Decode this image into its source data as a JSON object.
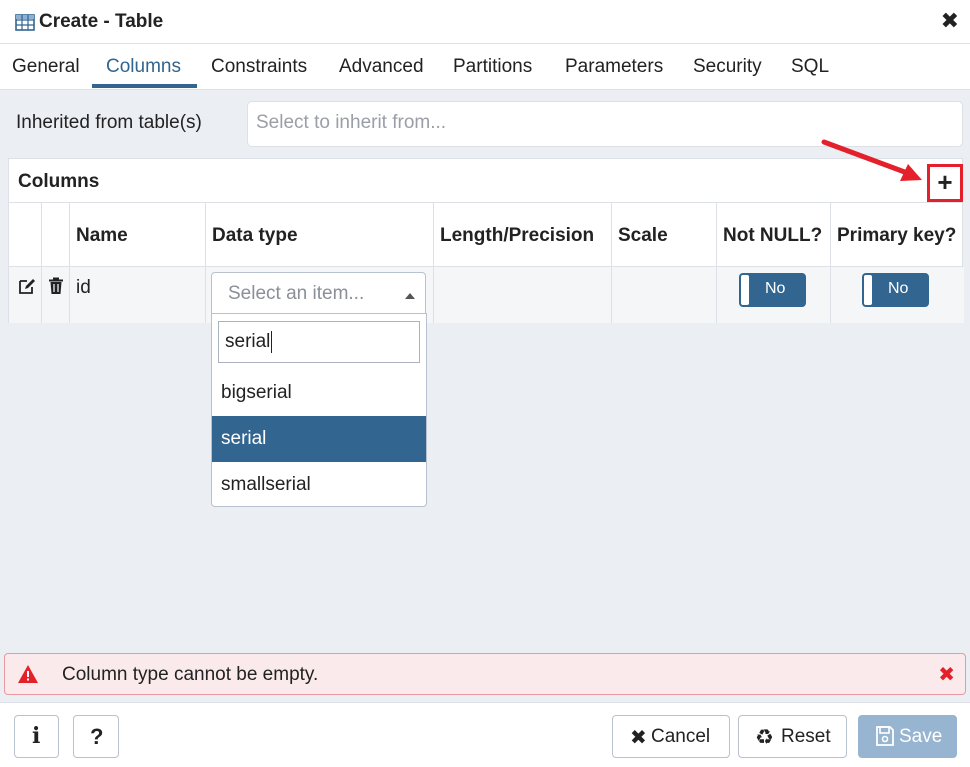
{
  "dialog": {
    "title": "Create - Table",
    "close_label": "✖"
  },
  "tabs": [
    {
      "label": "General"
    },
    {
      "label": "Columns"
    },
    {
      "label": "Constraints"
    },
    {
      "label": "Advanced"
    },
    {
      "label": "Partitions"
    },
    {
      "label": "Parameters"
    },
    {
      "label": "Security"
    },
    {
      "label": "SQL"
    }
  ],
  "active_tab": "Columns",
  "inherit": {
    "label": "Inherited from table(s)",
    "placeholder": "Select to inherit from..."
  },
  "columns": {
    "title": "Columns",
    "add_label": "+",
    "headers": {
      "name": "Name",
      "data_type": "Data type",
      "length": "Length/Precision",
      "scale": "Scale",
      "not_null": "Not NULL?",
      "primary_key": "Primary key?"
    },
    "rows": [
      {
        "name": "id",
        "data_type_placeholder": "Select an item...",
        "length": "",
        "scale": "",
        "not_null": "No",
        "primary_key": "No"
      }
    ]
  },
  "dropdown": {
    "search_value": "serial",
    "options": [
      {
        "label": "bigserial",
        "selected": false
      },
      {
        "label": "serial",
        "selected": true
      },
      {
        "label": "smallserial",
        "selected": false
      }
    ]
  },
  "error": {
    "message": "Column type cannot be empty.",
    "close_label": "✖"
  },
  "footer": {
    "info_label": "i",
    "help_label": "?",
    "cancel_label": "Cancel",
    "reset_label": "Reset",
    "save_label": "Save"
  },
  "colors": {
    "accent": "#326690",
    "error_bg": "#fbeaec",
    "error_red": "#e4202a",
    "save_disabled": "#97b5d1",
    "annotation_red": "#e4202a"
  }
}
